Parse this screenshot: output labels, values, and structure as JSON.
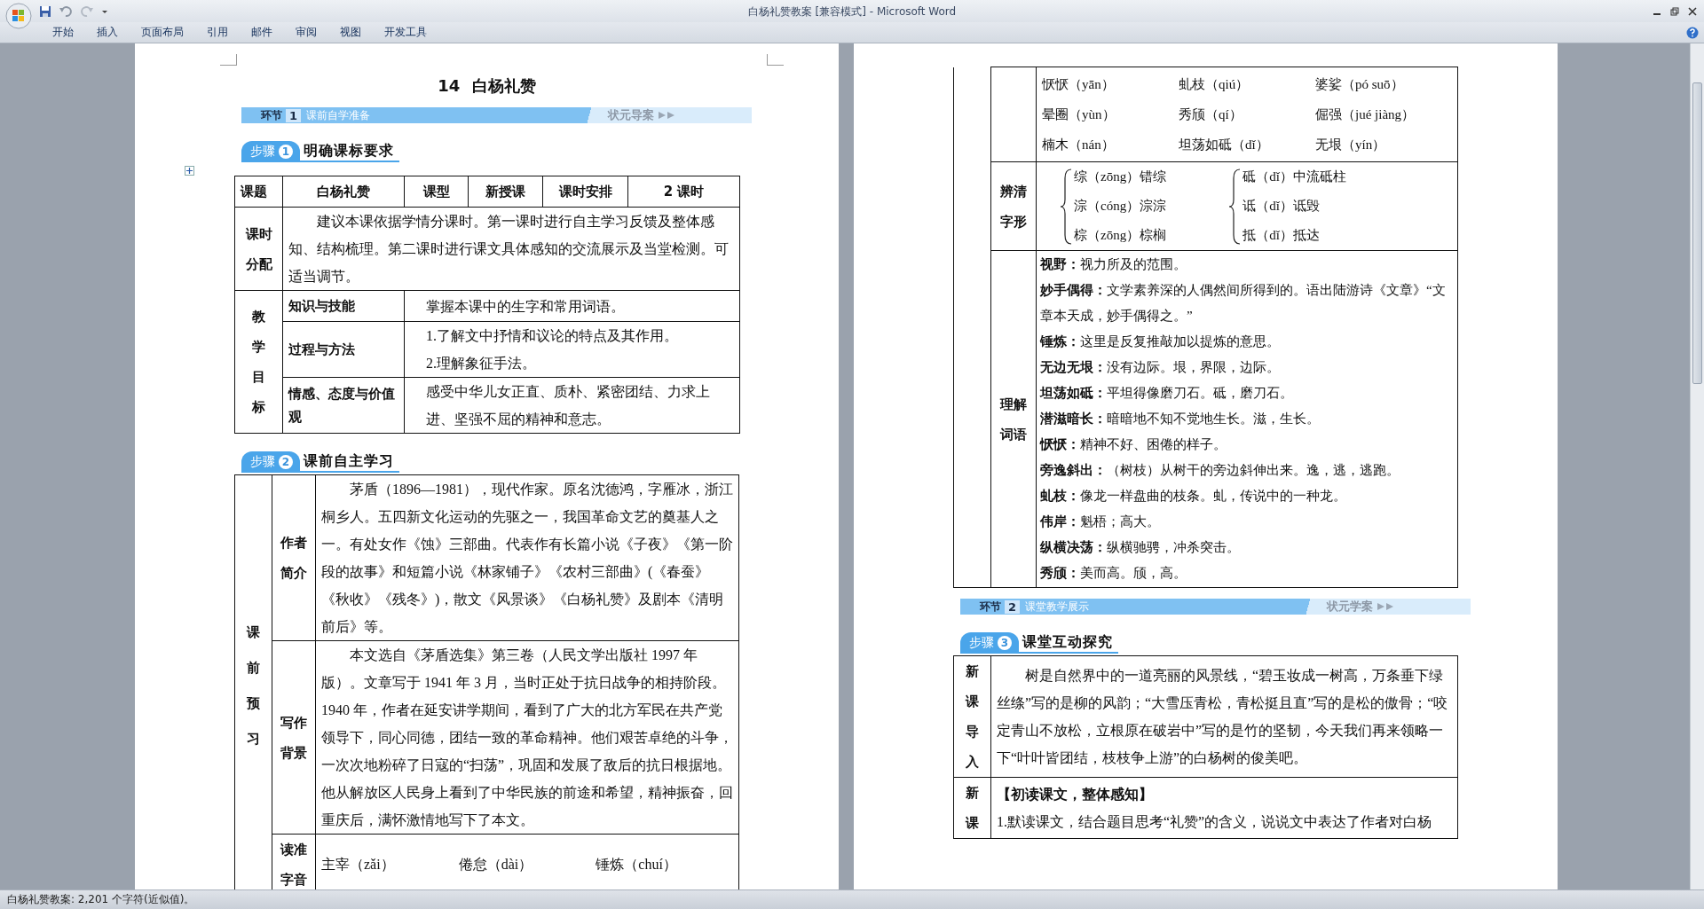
{
  "window": {
    "title": "白杨礼赞教案 [兼容模式] - Microsoft Word"
  },
  "ribbon_tabs": [
    "开始",
    "插入",
    "页面布局",
    "引用",
    "邮件",
    "审阅",
    "视图",
    "开发工具"
  ],
  "left_page": {
    "title": "14 白杨礼赞",
    "banner": {
      "label": "环节",
      "number": "1",
      "text": "课前自学准备",
      "brand": "状元**导案**"
    },
    "step": {
      "label": "步骤",
      "number": "1",
      "title": "明确课标要求"
    },
    "overview_table": {
      "header": [
        "课题",
        "白杨礼赞",
        "课型",
        "新授课",
        "课时安排",
        "2 课时"
      ],
      "schedule": {
        "heading": "课时分配",
        "text": "建议本课依据学情分课时。第一课时进行自主学习反馈及整体感知、结构梳理。第二课时进行课文具体感知的交流展示及当堂检测。可适当调节。"
      },
      "objectives": {
        "heading": "教学目标",
        "rows": [
          {
            "aspect": "知识与技能",
            "lines": [
              "掌握本课中的生字和常用词语。"
            ]
          },
          {
            "aspect": "过程与方法",
            "lines": [
              "1.了解文中抒情和议论的特点及其作用。",
              "2.理解象征手法。"
            ]
          },
          {
            "aspect": "情感、态度与价值观",
            "lines": [
              "感受中华儿女正直、质朴、紧密团结、力求上进、坚强不屈的精神和意志。"
            ]
          }
        ]
      }
    },
    "step_2": {
      "label": "步骤",
      "number": "2",
      "title": "课前自主学习"
    },
    "preview_table": {
      "heading": "课前预习",
      "rows": [
        {
          "kind": "paragraph",
          "heading": "作者简介",
          "text": "茅盾（1896—1981），现代作家。原名沈德鸿，字雁冰，浙江桐乡人。五四新文化运动的先驱之一，我国革命文艺的奠基人之一。有处女作《蚀》三部曲。代表作有长篇小说《子夜》《第一阶段的故事》和短篇小说《林家铺子》《农村三部曲》(《春蚕》《秋收》《残冬》)，散文《风景谈》《白杨礼赞》及剧本《清明前后》等。"
        },
        {
          "kind": "paragraph",
          "heading": "写作背景",
          "text": "本文选自《茅盾选集》第三卷（人民文学出版社 1997 年版）。文章写于 1941 年 3 月，当时正处于抗日战争的相持阶段。1940 年，作者在延安讲学期间，看到了广大的北方军民在共产党领导下，同心同德，团结一致的革命精神。他们艰苦卓绝的斗争，一次次地粉碎了日寇的“扫荡”，巩固和发展了敌后的抗日根据地。他从解放区人民身上看到了中华民族的前途和希望，精神振奋，回重庆后，满怀激情地写下了本文。"
        },
        {
          "kind": "pinyin",
          "heading": "读准字音",
          "items": [
            "主宰（zǎi）",
            "倦怠（dài）",
            "锤炼（chuí）"
          ]
        }
      ]
    }
  },
  "right_page": {
    "continued_table": {
      "rows": [
        {
          "kind": "pinyin",
          "items": [
            "恹恹（yān）",
            "虬枝（qiú）",
            "婆娑（pó suō）",
            "晕圈（yùn）",
            "秀颀（qí）",
            "倔强（jué jiàng）",
            "楠木（nán）",
            "坦荡如砥（dǐ）",
            "无垠（yín）"
          ]
        },
        {
          "kind": "glyphs",
          "heading": "辨清字形",
          "groups": [
            [
              "综（zōng）错综",
              "淙（cóng）淙淙",
              "棕（zōng）棕榈"
            ],
            [
              "砥（dǐ）中流砥柱",
              "诋（dǐ）诋毁",
              "抵（dǐ）抵达"
            ]
          ]
        },
        {
          "kind": "terms",
          "heading": "理解词语",
          "entries": [
            "**视野：**视力所及的范围。",
            "**妙手偶得：**文学素养深的人偶然间所得到的。语出陆游诗《文章》“文章本天成，妙手偶得之。”",
            "**锤炼：**这里是反复推敲加以提炼的意思。",
            "**无边无垠：**没有边际。垠，界限，边际。",
            "**坦荡如砥：**平坦得像磨刀石。砥，磨刀石。",
            "**潜滋暗长：**暗暗地不知不觉地生长。滋，生长。",
            "**恹恹：**精神不好、困倦的样子。",
            "**旁逸斜出：**（树枝）从树干的旁边斜伸出来。逸，逃，逃跑。",
            "**虬枝：**像龙一样盘曲的枝条。虬，传说中的一种龙。",
            "**伟岸：**魁梧；高大。",
            "**纵横决荡：**纵横驰骋，冲杀突击。",
            "**秀颀：**美而高。颀，高。"
          ]
        }
      ]
    },
    "banner": {
      "label": "环节",
      "number": "2",
      "text": "课堂教学展示",
      "brand": "状元**学案**"
    },
    "step": {
      "label": "步骤",
      "number": "3",
      "title": "课堂互动探究"
    },
    "class_table": {
      "rows": [
        {
          "kind": "paragraph",
          "heading": "新课导入",
          "text": "树是自然界中的一道亮丽的风景线，“碧玉妆成一树高，万条垂下绿丝绦”写的是柳的风韵；“大雪压青松，青松挺且直”写的是松的傲骨；“咬定青山不放松，立根原在破岩中”写的是竹的坚韧，今天我们再来领略一下“叶叶皆团结，枝枝争上游”的白杨树的俊美吧。"
        },
        {
          "kind": "task",
          "heading": "新课",
          "title": "【初读课文，整体感知】",
          "lines": [
            "1.默读课文，结合题目思考“礼赞”的含义，说说文中表达了作者对白杨"
          ]
        }
      ]
    }
  },
  "status_bar": {
    "text": "白杨礼赞教案: 2,201 个字符(近似值)。"
  }
}
